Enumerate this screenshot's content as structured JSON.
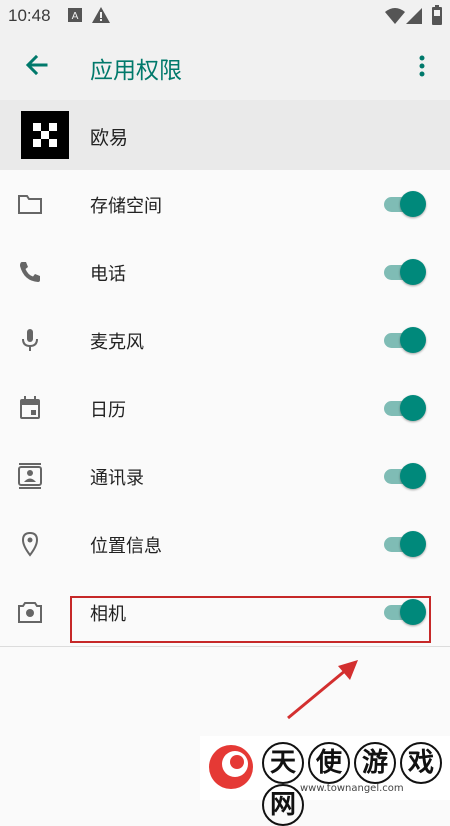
{
  "status_bar": {
    "time": "10:48",
    "icons": [
      "a-notification-icon",
      "alert-icon",
      "wifi-icon",
      "signal-icon",
      "battery-icon"
    ]
  },
  "app_bar": {
    "title": "应用权限",
    "back_icon": "arrow-back-icon",
    "menu_icon": "more-vert-icon",
    "accent": "#00796b"
  },
  "app": {
    "name": "欧易",
    "logo_icon": "okx-logo"
  },
  "permissions": [
    {
      "label": "存储空间",
      "icon": "folder-icon",
      "enabled": true
    },
    {
      "label": "电话",
      "icon": "phone-icon",
      "enabled": true
    },
    {
      "label": "麦克风",
      "icon": "mic-icon",
      "enabled": true
    },
    {
      "label": "日历",
      "icon": "calendar-icon",
      "enabled": true
    },
    {
      "label": "通讯录",
      "icon": "contacts-icon",
      "enabled": true
    },
    {
      "label": "位置信息",
      "icon": "location-icon",
      "enabled": true
    },
    {
      "label": "相机",
      "icon": "camera-icon",
      "enabled": true
    }
  ],
  "switch_colors": {
    "thumb": "#00897b",
    "track": "#7fbcb5"
  },
  "annotation": {
    "highlight_color": "#c62828",
    "highlighted_item": "相机"
  },
  "watermark": {
    "chars": [
      "天",
      "使",
      "游",
      "戏",
      "网"
    ],
    "url": "www.townangel.com"
  }
}
